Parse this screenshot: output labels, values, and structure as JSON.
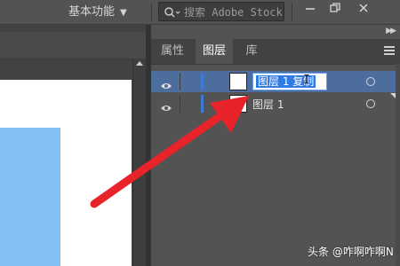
{
  "topbar": {
    "workspace_label": "基本功能",
    "search_placeholder": "搜索 Adobe Stock"
  },
  "panel": {
    "tabs": [
      {
        "label": "属性"
      },
      {
        "label": "图层"
      },
      {
        "label": "库"
      }
    ],
    "active_tab": "图层",
    "layers": [
      {
        "name_edit_value": "图层 1 复制",
        "state": "editing"
      },
      {
        "name": "图层 1",
        "state": "normal"
      }
    ]
  },
  "watermark": "头条 @咋啊咋啊N",
  "colors": {
    "selected_row": "#4d6d9c",
    "layer_color": "#3d7ad6",
    "arrow": "#e8232a",
    "canvas_shape": "#82bff5"
  },
  "icons": [
    "chevron-down-icon",
    "search-icon",
    "minimize-icon",
    "restore-icon",
    "close-icon",
    "collapse-icon",
    "panel-menu-icon",
    "eye-icon",
    "target-icon",
    "red-arrow-annotation"
  ]
}
